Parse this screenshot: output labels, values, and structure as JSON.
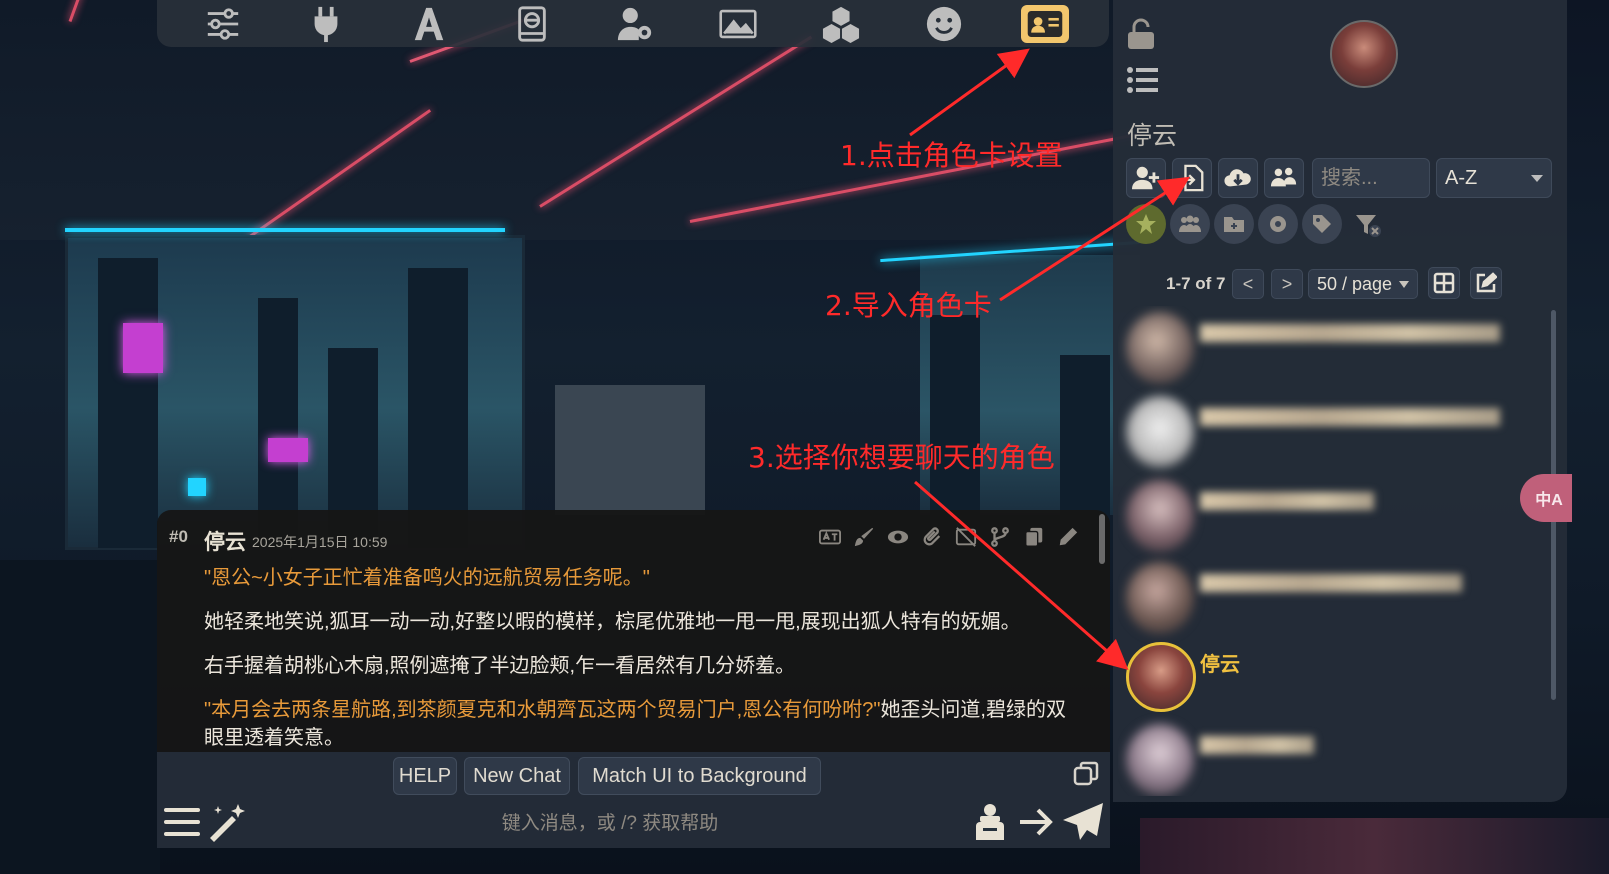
{
  "top_toolbar": {
    "icons": [
      "sliders-icon",
      "plug-icon",
      "font-icon",
      "book-icon",
      "user-gear-icon",
      "image-icon",
      "cubes-icon",
      "smile-icon",
      "id-card-icon"
    ],
    "active": "id-card-icon",
    "active_color": "#f2c66d"
  },
  "right_panel": {
    "title": "停云",
    "search": {
      "placeholder": "搜索..."
    },
    "sort": {
      "selected": "A-Z"
    },
    "pager": {
      "count": "1-7 of 7",
      "prev": "<",
      "next": ">",
      "page_size": "50 / page"
    },
    "characters": [
      {
        "name": "",
        "blurred": true
      },
      {
        "name": "",
        "blurred": true
      },
      {
        "name": "",
        "blurred": true
      },
      {
        "name": "",
        "blurred": true
      },
      {
        "name": "停云",
        "blurred": false,
        "selected": true
      },
      {
        "name": "",
        "blurred": true
      }
    ],
    "selected_color": "#f0c040",
    "translate_label": "中A"
  },
  "chat": {
    "message": {
      "index": "#0",
      "author": "停云",
      "time": "2025年1月15日 10:59",
      "paragraphs": [
        {
          "text": "\"恩公~小女子正忙着准备鸣火的远航贸易任务呢。\"",
          "style": "quote"
        },
        {
          "text": "她轻柔地笑说,狐耳一动一动,好整以暇的模样，棕尾优雅地一甩一甩,展现出狐人特有的妩媚。",
          "style": "plain"
        },
        {
          "text": "右手握着胡桃心木扇,照例遮掩了半边脸颊,乍一看居然有几分娇羞。",
          "style": "plain"
        },
        {
          "text_quote": "\"本月会去两条星航路,到茶颜夏克和水朝齊瓦这两个贸易门户,恩公有何吩咐?\"",
          "text_rest": "她歪头问道,碧绿的双眼里透着笑意。",
          "style": "mixed"
        }
      ],
      "tools": [
        "translate-icon",
        "brush-icon",
        "eye-icon",
        "paperclip-icon",
        "image-off-icon",
        "branch-icon",
        "copy-icon",
        "pencil-icon"
      ]
    },
    "quick_replies": [
      "HELP",
      "New Chat",
      "Match UI to Background"
    ],
    "input": {
      "placeholder": "键入消息，或 /? 获取帮助"
    }
  },
  "annotations": {
    "step1": "1.点击角色卡设置",
    "step2": "2.导入角色卡",
    "step3": "3.选择你想要聊天的角色",
    "color": "#ff2a2a"
  }
}
